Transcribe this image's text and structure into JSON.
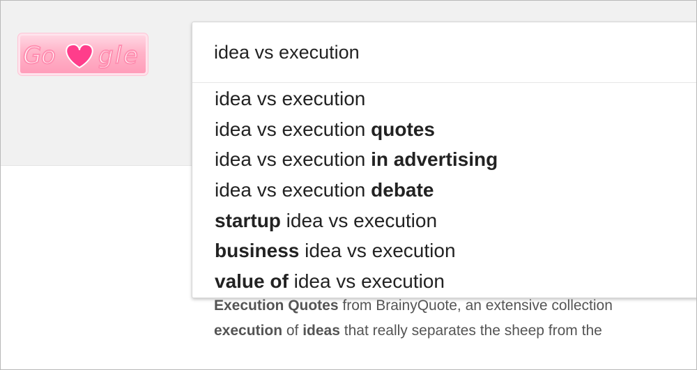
{
  "logo": {
    "text": "Go gle",
    "name": "Google doodle logo"
  },
  "search": {
    "query": "idea vs execution"
  },
  "suggestions": [
    {
      "pre": "idea vs execution",
      "bold": "",
      "post": ""
    },
    {
      "pre": "idea vs execution ",
      "bold": "quotes",
      "post": ""
    },
    {
      "pre": "idea vs execution ",
      "bold": "in advertising",
      "post": ""
    },
    {
      "pre": "idea vs execution ",
      "bold": "debate",
      "post": ""
    },
    {
      "pre": "",
      "bold": "startup",
      "post": " idea vs execution"
    },
    {
      "pre": "",
      "bold": "business",
      "post": " idea vs execution"
    },
    {
      "pre": "",
      "bold": "value of",
      "post": " idea vs execution"
    }
  ],
  "result_snippet": {
    "line1": {
      "b1": "Execution Quotes",
      "t1": " from BrainyQuote, an extensive collection"
    },
    "line2": {
      "b1": "execution",
      "t1": " of ",
      "b2": "ideas",
      "t2": " that really separates the sheep from the"
    }
  },
  "colors": {
    "header_bg": "#f1f1f1",
    "logo_pink": "#ff8fb1",
    "heart": "#ff3d8b",
    "text": "#222222",
    "snippet_text": "#545454"
  }
}
